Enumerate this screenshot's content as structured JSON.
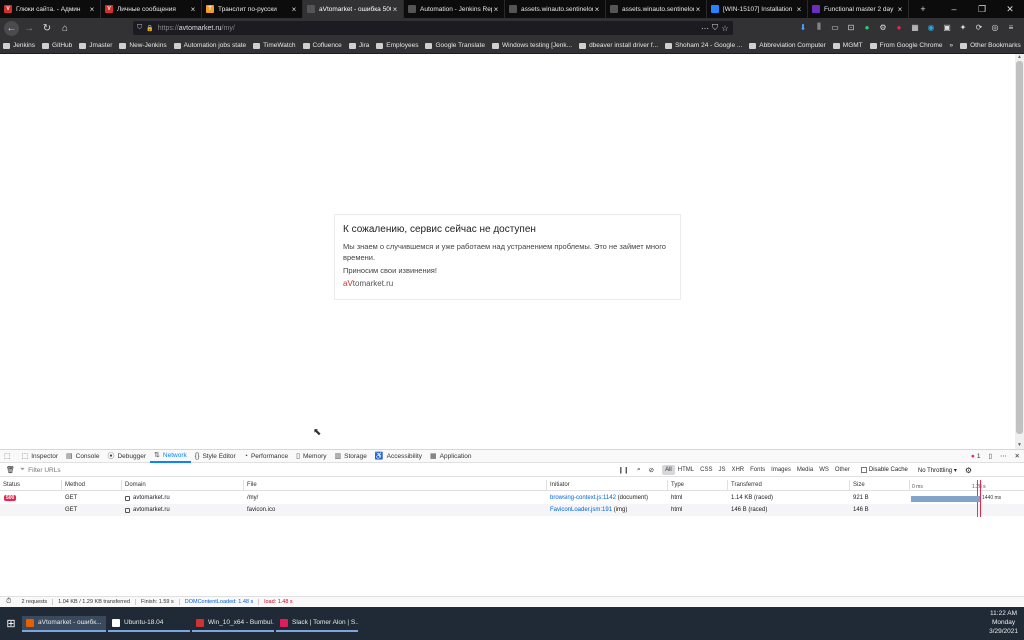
{
  "browser": {
    "tabs": [
      {
        "label": "Глюки сайта. - Админ",
        "color": "#d0312d",
        "glyph": "V"
      },
      {
        "label": "Личные сообщения",
        "color": "#d0312d",
        "glyph": "V"
      },
      {
        "label": "Транслит по-русски",
        "color": "#f59d2a",
        "glyph": "T"
      },
      {
        "label": "aVtomarket - ошибка 500",
        "color": "#555555",
        "glyph": ""
      },
      {
        "label": "Automation - Jenkins Report",
        "color": "#555555",
        "glyph": ""
      },
      {
        "label": "assets.winauto.sentinelone.",
        "color": "#555555",
        "glyph": ""
      },
      {
        "label": "assets.winauto.sentinelone.",
        "color": "#555555",
        "glyph": ""
      },
      {
        "label": "[WIN-15107] Installation",
        "color": "#2684ff",
        "glyph": ""
      },
      {
        "label": "Functional master 2 day",
        "color": "#6b2fbf",
        "glyph": ""
      }
    ],
    "url_prefix": "https://",
    "url_host": "avtomarket.ru",
    "url_path": "/my/",
    "bookmarks": [
      "Jenkins",
      "GitHub",
      "Jmaster",
      "New-Jenkins",
      "Automation jobs state",
      "TimeWatch",
      "Cofluence",
      "Jira",
      "Employees",
      "Google Translate",
      "Windows testing [Jenk...",
      "dbeaver install driver f...",
      "Shoham 24 - Google ...",
      "Abbreviation Computer",
      "MGMT",
      "From Google Chrome"
    ],
    "other_bookmarks": "Other Bookmarks"
  },
  "page": {
    "heading": "К сожалению, сервис сейчас не доступен",
    "paragraph": "Мы знаем о случившемся и уже работаем над устранением проблемы. Это не займет много времени.",
    "apology": "Приносим свои извинения!",
    "brand_a": "aV",
    "brand_rest": "tomarket.ru"
  },
  "devtools": {
    "tabs": [
      "Inspector",
      "Console",
      "Debugger",
      "Network",
      "Style Editor",
      "Performance",
      "Memory",
      "Storage",
      "Accessibility",
      "Application"
    ],
    "error_count": "1",
    "filter_placeholder": "Filter URLs",
    "type_filters": [
      "All",
      "HTML",
      "CSS",
      "JS",
      "XHR",
      "Fonts",
      "Images",
      "Media",
      "WS",
      "Other"
    ],
    "disable_cache": "Disable Cache",
    "throttling": "No Throttling",
    "columns": [
      "Status",
      "Method",
      "Domain",
      "File",
      "Initiator",
      "Type",
      "Transferred",
      "Size"
    ],
    "wf_ticks": [
      "0 ms",
      "1.28 s"
    ],
    "rows": [
      {
        "status": "500",
        "method": "GET",
        "domain": "avtomarket.ru",
        "file": "/my/",
        "initiator": "browsing-context.js:1142",
        "initiator_note": "(document)",
        "type": "html",
        "transferred": "1.14 KB (raced)",
        "size": "921 B",
        "timing": "1440 ms"
      },
      {
        "status": "",
        "method": "GET",
        "domain": "avtomarket.ru",
        "file": "favicon.ico",
        "initiator": "FaviconLoader.jsm:191",
        "initiator_note": "(img)",
        "type": "html",
        "transferred": "146 B (raced)",
        "size": "146 B",
        "timing": ""
      }
    ],
    "status_bar": {
      "requests": "2 requests",
      "transferred": "1.04 KB / 1.29 KB transferred",
      "finish": "Finish: 1.59 s",
      "dcl": "DOMContentLoaded: 1.48 s",
      "load": "load: 1.48 s"
    }
  },
  "taskbar": {
    "items": [
      {
        "label": "aVtomarket - ошибк...",
        "color": "#e66000"
      },
      {
        "label": "Ubuntu-18.04",
        "color": "#ffffff"
      },
      {
        "label": "Win_10_x64 - Bumbul...",
        "color": "#cc3333"
      },
      {
        "label": "Slack | Tomer Alon | S...",
        "color": "#e01e5a"
      }
    ],
    "time": "11:22 AM",
    "day": "Monday",
    "date": "3/29/2021"
  }
}
